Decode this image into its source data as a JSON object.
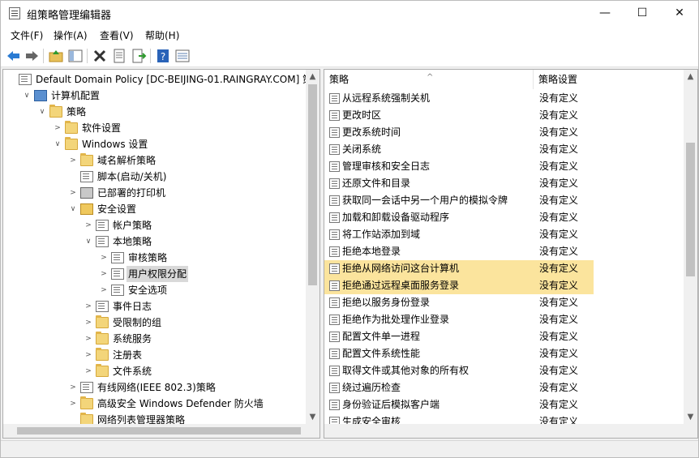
{
  "window": {
    "title": "组策略管理编辑器",
    "controls": {
      "minimize": "—",
      "maximize": "☐",
      "close": "✕"
    }
  },
  "menu": [
    "文件(F)",
    "操作(A)",
    "查看(V)",
    "帮助(H)"
  ],
  "toolbar": {
    "icons": [
      "back-icon",
      "forward-icon",
      "up-folder-icon",
      "show-hide-tree-icon",
      "delete-icon",
      "properties-icon",
      "export-list-icon",
      "help-icon",
      "details-view-icon"
    ]
  },
  "tree": [
    {
      "label": "Default Domain Policy [DC-BEIJING-01.RAINGRAY.COM] 策略",
      "icon": "policy-icon",
      "expander": ""
    },
    {
      "label": "计算机配置",
      "icon": "computer-icon",
      "expander": "∨"
    },
    {
      "label": "策略",
      "icon": "folder-icon",
      "expander": "∨"
    },
    {
      "label": "软件设置",
      "icon": "folder-icon",
      "expander": ">"
    },
    {
      "label": "Windows 设置",
      "icon": "folder-icon",
      "expander": "∨"
    },
    {
      "label": "域名解析策略",
      "icon": "folder-icon",
      "expander": ">"
    },
    {
      "label": "脚本(启动/关机)",
      "icon": "document-icon",
      "expander": ""
    },
    {
      "label": "已部署的打印机",
      "icon": "printer-icon",
      "expander": ">"
    },
    {
      "label": "安全设置",
      "icon": "shield-icon",
      "expander": "∨"
    },
    {
      "label": "帐户策略",
      "icon": "document-icon",
      "expander": ">"
    },
    {
      "label": "本地策略",
      "icon": "document-icon",
      "expander": "∨"
    },
    {
      "label": "审核策略",
      "icon": "document-icon",
      "expander": ">"
    },
    {
      "label": "用户权限分配",
      "icon": "document-icon",
      "expander": ">",
      "selected": true
    },
    {
      "label": "安全选项",
      "icon": "document-icon",
      "expander": ">"
    },
    {
      "label": "事件日志",
      "icon": "document-icon",
      "expander": ">"
    },
    {
      "label": "受限制的组",
      "icon": "folder-icon",
      "expander": ">"
    },
    {
      "label": "系统服务",
      "icon": "folder-icon",
      "expander": ">"
    },
    {
      "label": "注册表",
      "icon": "folder-icon",
      "expander": ">"
    },
    {
      "label": "文件系统",
      "icon": "folder-icon",
      "expander": ">"
    },
    {
      "label": "有线网络(IEEE 802.3)策略",
      "icon": "document-icon",
      "expander": ">"
    },
    {
      "label": "高级安全 Windows Defender 防火墙",
      "icon": "folder-icon",
      "expander": ">"
    },
    {
      "label": "网络列表管理器策略",
      "icon": "folder-icon",
      "expander": ""
    }
  ],
  "list": {
    "headers": {
      "policy": "策略",
      "setting": "策略设置"
    },
    "rows": [
      {
        "name": "从远程系统强制关机",
        "setting": "没有定义"
      },
      {
        "name": "更改时区",
        "setting": "没有定义"
      },
      {
        "name": "更改系统时间",
        "setting": "没有定义"
      },
      {
        "name": "关闭系统",
        "setting": "没有定义"
      },
      {
        "name": "管理审核和安全日志",
        "setting": "没有定义"
      },
      {
        "name": "还原文件和目录",
        "setting": "没有定义"
      },
      {
        "name": "获取同一会话中另一个用户的模拟令牌",
        "setting": "没有定义"
      },
      {
        "name": "加载和卸载设备驱动程序",
        "setting": "没有定义"
      },
      {
        "name": "将工作站添加到域",
        "setting": "没有定义"
      },
      {
        "name": "拒绝本地登录",
        "setting": "没有定义"
      },
      {
        "name": "拒绝从网络访问这台计算机",
        "setting": "没有定义",
        "highlight": true
      },
      {
        "name": "拒绝通过远程桌面服务登录",
        "setting": "没有定义",
        "highlight": true
      },
      {
        "name": "拒绝以服务身份登录",
        "setting": "没有定义"
      },
      {
        "name": "拒绝作为批处理作业登录",
        "setting": "没有定义"
      },
      {
        "name": "配置文件单一进程",
        "setting": "没有定义"
      },
      {
        "name": "配置文件系统性能",
        "setting": "没有定义"
      },
      {
        "name": "取得文件或其他对象的所有权",
        "setting": "没有定义"
      },
      {
        "name": "绕过遍历检查",
        "setting": "没有定义"
      },
      {
        "name": "身份验证后模拟客户端",
        "setting": "没有定义"
      },
      {
        "name": "生成安全审核",
        "setting": "没有定义"
      }
    ]
  },
  "colors": {
    "highlight": "#fbe49d",
    "selected": "#d9d9d9",
    "pane_border": "#adadad"
  }
}
